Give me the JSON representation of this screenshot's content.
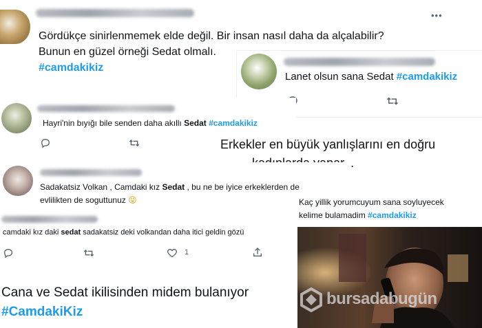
{
  "tweet1": {
    "line1": "Gördükçe sinirlenmemek elde değil. Bir insan nasıl daha da alçalabilir?",
    "line2": "Bunun en güzel örneği Sedat olmalı.",
    "hashtag": "#camdakikiz",
    "more_icon": "•••"
  },
  "tweet2": {
    "text": "Lanet olsun sana Sedat",
    "hashtag": "#camdakikiz",
    "reply_icon": "reply-icon",
    "retweet_icon": "retweet-icon"
  },
  "tweet3": {
    "text_prefix": "Hayri'nin bıyığı bile senden daha akıllı",
    "bold": "Sedat",
    "hashtag": "#camdakikiz"
  },
  "tweet4": {
    "line1": "Erkekler en büyük yanlışlarını en doğru",
    "line2": "kadınlarda yapar..."
  },
  "tweet5": {
    "line1_a": "Sadakatsiz Volkan , Camdaki kız",
    "line1_bold": "Sedat",
    "line1_b": ", bu ne be iyice erkeklerden de",
    "line2": "evlilikten de soguttunuz",
    "emoji": "😝"
  },
  "tweet6": {
    "line1": "Kaç yillik yorumcuyum sana soyluyecek",
    "line2_a": "kelime bulamadim",
    "hashtag": "#camdakikiz"
  },
  "tweet7": {
    "text_a": "camdaki kız daki",
    "bold": "sedat",
    "text_b": "sadakatsiz deki volkandan daha itici geldin gözü",
    "like_count": "1"
  },
  "tweet8": {
    "text": "Cana ve Sedat ikilisinden midem bulanıyor",
    "hashtag": "#CamdakiKiz"
  },
  "watermark": "bursadabugün",
  "colors": {
    "accent": "#1d9bf0",
    "text": "#0f1419",
    "muted": "#536471"
  }
}
